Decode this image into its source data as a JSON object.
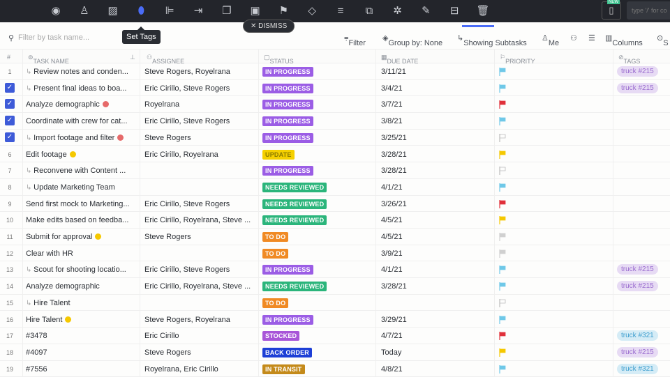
{
  "toolbar": {
    "icons": [
      "eye-icon",
      "add-assignee-icon",
      "stripe-icon",
      "tag-icon",
      "subtask-icon",
      "move-icon",
      "duplicate-icon",
      "calendar-icon",
      "flag-icon",
      "status-icon",
      "dependency-icon",
      "copy-icon",
      "merge-icon",
      "edit-icon",
      "archive-icon",
      "trash-icon"
    ],
    "new_badge": "NEW",
    "command_placeholder": "type '/' for co"
  },
  "tooltip": "Set Tags",
  "dismiss": "DISMISS",
  "filterbar": {
    "search_placeholder": "Filter by task name...",
    "filter": "Filter",
    "group_by": "Group by: None",
    "subtasks": "Showing Subtasks",
    "me": "Me",
    "columns": "Columns",
    "more": "S"
  },
  "headers": {
    "num": "#",
    "task": "TASK NAME",
    "assignee": "ASSIGNEE",
    "status": "STATUS",
    "due": "DUE DATE",
    "priority": "PRIORITY",
    "tags": "TAGS"
  },
  "colors": {
    "in_progress": "#9b5de5",
    "update": "#f5d000",
    "needs_reviewed": "#2bb57b",
    "to_do": "#f08a24",
    "stocked": "#a855d8",
    "back_order": "#1d3fd6",
    "in_transit": "#c48a1a",
    "flag_blue": "#6fc8e8",
    "flag_red": "#e0303a",
    "flag_yellow": "#f5c800",
    "flag_gray": "#d0d0d0"
  },
  "rows": [
    {
      "num": "1",
      "checked": false,
      "subtask": true,
      "name": "Review notes and conden...",
      "dot": "",
      "assignee": "Steve Rogers, Royelrana",
      "status": "IN PROGRESS",
      "sc": "in_progress",
      "due": "3/11/21",
      "flag": "flag_blue",
      "tag": "truck #215"
    },
    {
      "num": "2",
      "checked": true,
      "subtask": true,
      "name": "Present final ideas to boa...",
      "dot": "",
      "assignee": "Eric Cirillo, Steve Rogers",
      "status": "IN PROGRESS",
      "sc": "in_progress",
      "due": "3/4/21",
      "flag": "flag_blue",
      "tag": "truck #215"
    },
    {
      "num": "3",
      "checked": true,
      "subtask": false,
      "name": "Analyze demographic",
      "dot": "red",
      "assignee": "Royelrana",
      "status": "IN PROGRESS",
      "sc": "in_progress",
      "due": "3/7/21",
      "flag": "flag_red",
      "tag": ""
    },
    {
      "num": "4",
      "checked": true,
      "subtask": false,
      "name": "Coordinate with crew for cat...",
      "dot": "",
      "assignee": "Eric Cirillo, Steve Rogers",
      "status": "IN PROGRESS",
      "sc": "in_progress",
      "due": "3/8/21",
      "flag": "flag_blue",
      "tag": ""
    },
    {
      "num": "5",
      "checked": true,
      "subtask": true,
      "name": "Import footage and filter",
      "dot": "red",
      "assignee": "Steve Rogers",
      "status": "IN PROGRESS",
      "sc": "in_progress",
      "due": "3/25/21",
      "flag": "outline",
      "tag": ""
    },
    {
      "num": "6",
      "checked": false,
      "subtask": false,
      "name": "Edit footage",
      "dot": "yellow",
      "assignee": "Eric Cirillo, Royelrana",
      "status": "UPDATE",
      "sc": "update",
      "due": "3/28/21",
      "flag": "flag_yellow",
      "tag": ""
    },
    {
      "num": "7",
      "checked": false,
      "subtask": true,
      "name": "Reconvene with Content ...",
      "dot": "",
      "assignee": "",
      "status": "IN PROGRESS",
      "sc": "in_progress",
      "due": "3/28/21",
      "flag": "outline",
      "tag": ""
    },
    {
      "num": "8",
      "checked": false,
      "subtask": true,
      "name": "Update Marketing Team",
      "dot": "",
      "assignee": "",
      "status": "NEEDS REVIEWED",
      "sc": "needs_reviewed",
      "due": "4/1/21",
      "flag": "flag_blue",
      "tag": ""
    },
    {
      "num": "9",
      "checked": false,
      "subtask": false,
      "name": "Send first mock to Marketing...",
      "dot": "",
      "assignee": "Eric Cirillo, Steve Rogers",
      "status": "NEEDS REVIEWED",
      "sc": "needs_reviewed",
      "due": "3/26/21",
      "flag": "flag_red",
      "tag": ""
    },
    {
      "num": "10",
      "checked": false,
      "subtask": false,
      "name": "Make edits based on feedba...",
      "dot": "",
      "assignee": "Eric Cirillo, Royelrana, Steve ...",
      "status": "NEEDS REVIEWED",
      "sc": "needs_reviewed",
      "due": "4/5/21",
      "flag": "flag_yellow",
      "tag": ""
    },
    {
      "num": "11",
      "checked": false,
      "subtask": false,
      "name": "Submit for approval",
      "dot": "yellow",
      "assignee": "Steve Rogers",
      "status": "TO DO",
      "sc": "to_do",
      "due": "4/5/21",
      "flag": "flag_gray",
      "tag": ""
    },
    {
      "num": "12",
      "checked": false,
      "subtask": false,
      "name": "Clear with HR",
      "dot": "",
      "assignee": "",
      "status": "TO DO",
      "sc": "to_do",
      "due": "3/9/21",
      "flag": "flag_gray",
      "tag": ""
    },
    {
      "num": "13",
      "checked": false,
      "subtask": true,
      "name": "Scout for shooting locatio...",
      "dot": "",
      "assignee": "Eric Cirillo, Steve Rogers",
      "status": "IN PROGRESS",
      "sc": "in_progress",
      "due": "4/1/21",
      "flag": "flag_blue",
      "tag": "truck #215"
    },
    {
      "num": "14",
      "checked": false,
      "subtask": false,
      "name": "Analyze demographic",
      "dot": "",
      "assignee": "Eric Cirillo, Royelrana, Steve ...",
      "status": "NEEDS REVIEWED",
      "sc": "needs_reviewed",
      "due": "3/28/21",
      "flag": "flag_blue",
      "tag": "truck #215"
    },
    {
      "num": "15",
      "checked": false,
      "subtask": true,
      "name": "Hire Talent",
      "dot": "",
      "assignee": "",
      "status": "TO DO",
      "sc": "to_do",
      "due": "",
      "flag": "outline",
      "tag": ""
    },
    {
      "num": "16",
      "checked": false,
      "subtask": false,
      "name": "Hire Talent",
      "dot": "yellow",
      "assignee": "Steve Rogers, Royelrana",
      "status": "IN PROGRESS",
      "sc": "in_progress",
      "due": "3/29/21",
      "flag": "flag_blue",
      "tag": ""
    },
    {
      "num": "17",
      "checked": false,
      "subtask": false,
      "name": "#3478",
      "dot": "",
      "assignee": "Eric Cirillo",
      "status": "STOCKED",
      "sc": "stocked",
      "due": "4/7/21",
      "flag": "flag_red",
      "tag": "truck #321"
    },
    {
      "num": "18",
      "checked": false,
      "subtask": false,
      "name": "#4097",
      "dot": "",
      "assignee": "Steve Rogers",
      "status": "BACK ORDER",
      "sc": "back_order",
      "due": "Today",
      "flag": "flag_yellow",
      "tag": "truck #215"
    },
    {
      "num": "19",
      "checked": false,
      "subtask": false,
      "name": "#7556",
      "dot": "",
      "assignee": "Royelrana, Eric Cirillo",
      "status": "IN TRANSIT",
      "sc": "in_transit",
      "due": "4/8/21",
      "flag": "flag_blue",
      "tag": "truck #321"
    }
  ]
}
